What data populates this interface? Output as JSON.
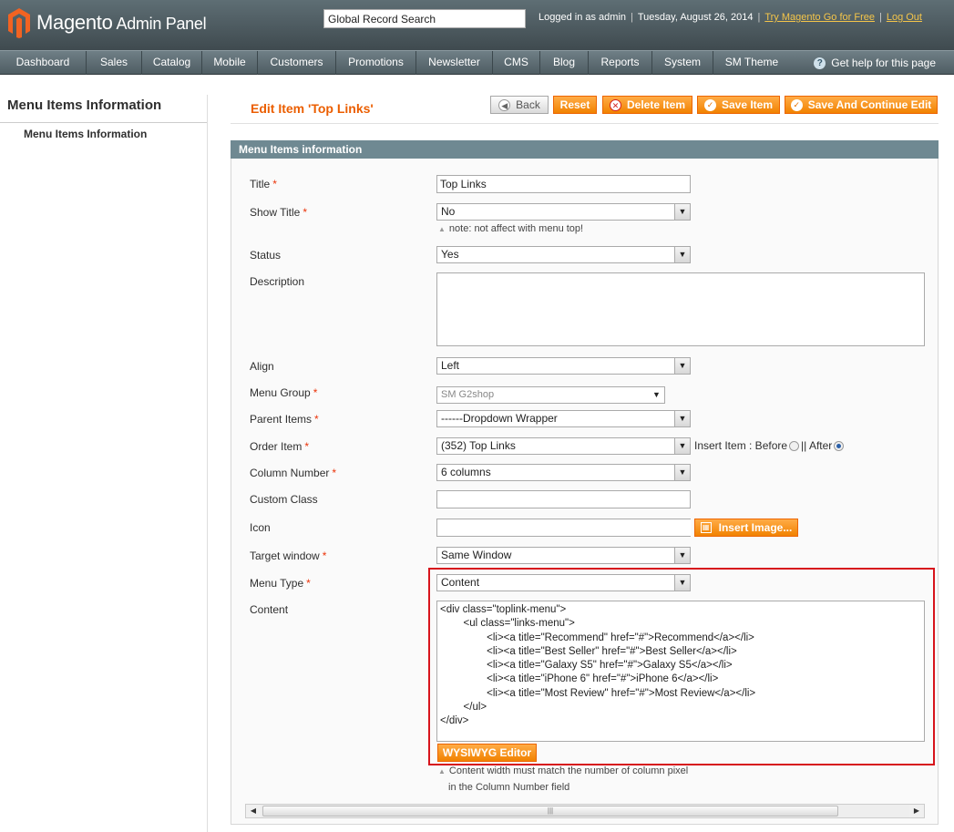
{
  "header": {
    "logo_brand": "Magento",
    "logo_sub": "Admin Panel",
    "search_value": "Global Record Search",
    "logged_in": "Logged in as admin",
    "date": "Tuesday, August 26, 2014",
    "try_link": "Try Magento Go for Free",
    "logout": "Log Out"
  },
  "nav": {
    "items": [
      "Dashboard",
      "Sales",
      "Catalog",
      "Mobile",
      "Customers",
      "Promotions",
      "Newsletter",
      "CMS",
      "Blog",
      "Reports",
      "System",
      "SM Theme"
    ],
    "help": "Get help for this page"
  },
  "sidebar": {
    "title": "Menu Items Information",
    "item": "Menu Items Information"
  },
  "page": {
    "title": "Edit Item 'Top Links'",
    "buttons": {
      "back": "Back",
      "reset": "Reset",
      "delete": "Delete Item",
      "save": "Save Item",
      "save_continue": "Save And Continue Edit"
    }
  },
  "section": {
    "title": "Menu Items information"
  },
  "form": {
    "title": {
      "label": "Title",
      "value": "Top Links"
    },
    "show_title": {
      "label": "Show Title",
      "value": "No",
      "note": "note: not affect with menu top!"
    },
    "status": {
      "label": "Status",
      "value": "Yes"
    },
    "description": {
      "label": "Description"
    },
    "align": {
      "label": "Align",
      "value": "Left"
    },
    "menu_group": {
      "label": "Menu Group",
      "value": "SM G2shop"
    },
    "parent_items": {
      "label": "Parent Items",
      "value": "------Dropdown Wrapper"
    },
    "order_item": {
      "label": "Order Item",
      "value": "(352) Top Links",
      "insert_label": "Insert Item : Before",
      "after_label": "|| After"
    },
    "column_number": {
      "label": "Column Number",
      "value": "6 columns"
    },
    "custom_class": {
      "label": "Custom Class"
    },
    "icon": {
      "label": "Icon",
      "button": "Insert Image..."
    },
    "target_window": {
      "label": "Target window",
      "value": "Same Window"
    },
    "menu_type": {
      "label": "Menu Type",
      "value": "Content"
    },
    "content": {
      "label": "Content",
      "code": "<div class=\"toplink-menu\">\n        <ul class=\"links-menu\">\n                <li><a title=\"Recommend\" href=\"#\">Recommend</a></li>\n                <li><a title=\"Best Seller\" href=\"#\">Best Seller</a></li>\n                <li><a title=\"Galaxy S5\" href=\"#\">Galaxy S5</a></li>\n                <li><a title=\"iPhone 6\" href=\"#\">iPhone 6</a></li>\n                <li><a title=\"Most Review\" href=\"#\">Most Review</a></li>\n        </ul>\n</div>",
      "wysiwyg": "WYSIWYG Editor",
      "note_line1": "Content width must match the number of column pixel",
      "note_line2": "in the Column Number field"
    }
  },
  "colors": {
    "accent": "#eb5e00",
    "header_bg": "#4f5d63",
    "section_head": "#6f8992",
    "highlight": "#d7141c"
  }
}
